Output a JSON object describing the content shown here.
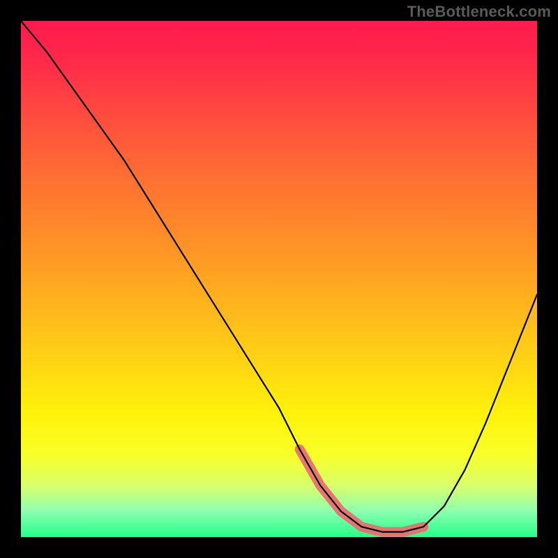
{
  "watermark": {
    "text": "TheBottleneck.com"
  },
  "colors": {
    "background": "#000000",
    "gradient_top": "#ff1a4d",
    "gradient_mid": "#ffd414",
    "gradient_bottom": "#22ff88",
    "curve": "#000000",
    "highlight": "#e87070"
  },
  "chart_data": {
    "type": "line",
    "title": "",
    "xlabel": "",
    "ylabel": "",
    "x_range": [
      0,
      100
    ],
    "y_range": [
      0,
      100
    ],
    "grid": false,
    "legend": false,
    "series": [
      {
        "name": "bottleneck-curve",
        "x": [
          0,
          5,
          10,
          15,
          20,
          25,
          30,
          35,
          40,
          45,
          50,
          54,
          58,
          62,
          66,
          70,
          74,
          78,
          82,
          86,
          90,
          94,
          98,
          100
        ],
        "y": [
          100,
          94,
          87,
          80,
          73,
          65,
          57,
          49,
          41,
          33,
          25,
          17,
          10,
          5,
          2,
          1,
          1,
          2,
          6,
          13,
          22,
          32,
          42,
          47
        ]
      },
      {
        "name": "current-range-highlight",
        "x": [
          54,
          58,
          62,
          66,
          70,
          74,
          78
        ],
        "y": [
          17,
          10,
          5,
          2,
          1,
          1,
          2
        ]
      }
    ],
    "annotations": [
      {
        "text": "TheBottleneck.com",
        "role": "watermark",
        "position": "top-right"
      }
    ]
  }
}
